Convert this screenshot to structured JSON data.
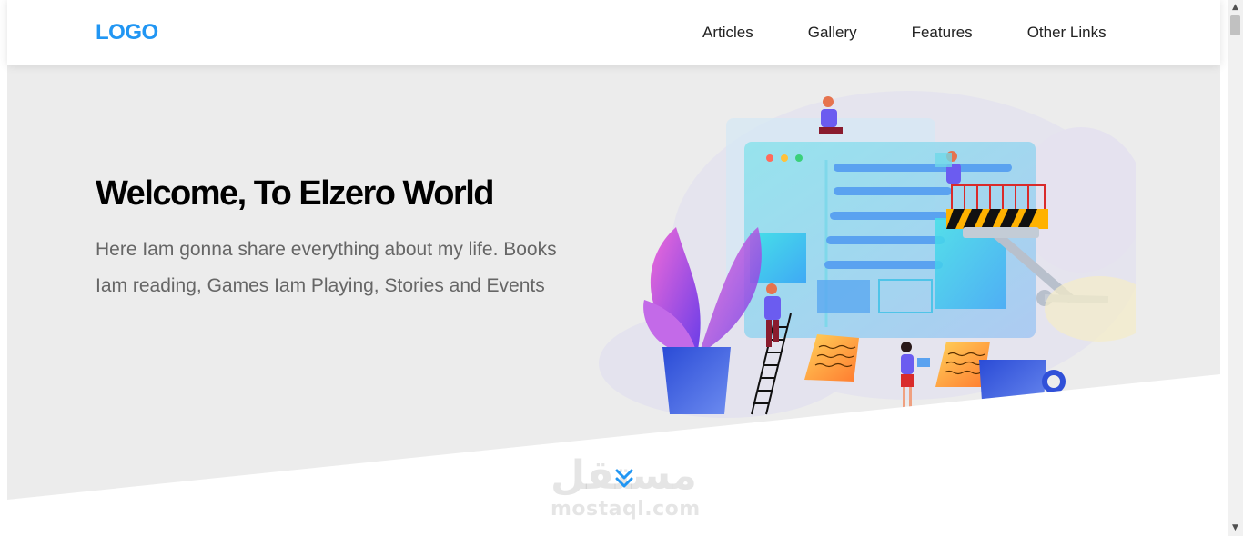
{
  "header": {
    "logo": "LOGO",
    "nav": [
      {
        "label": "Articles"
      },
      {
        "label": "Gallery"
      },
      {
        "label": "Features"
      },
      {
        "label": "Other Links"
      }
    ]
  },
  "hero": {
    "title": "Welcome, To Elzero World",
    "description": "Here Iam gonna share everything about my life. Books Iam reading, Games Iam Playing, Stories and Events"
  },
  "go_down_icon": "chevron-double-down-icon",
  "watermark": {
    "arabic": "مستقل",
    "latin": "mostaql.com"
  },
  "colors": {
    "accent": "#2196f3",
    "hero_background": "#ececec",
    "text_dark": "#000000",
    "text_muted": "#666666"
  }
}
